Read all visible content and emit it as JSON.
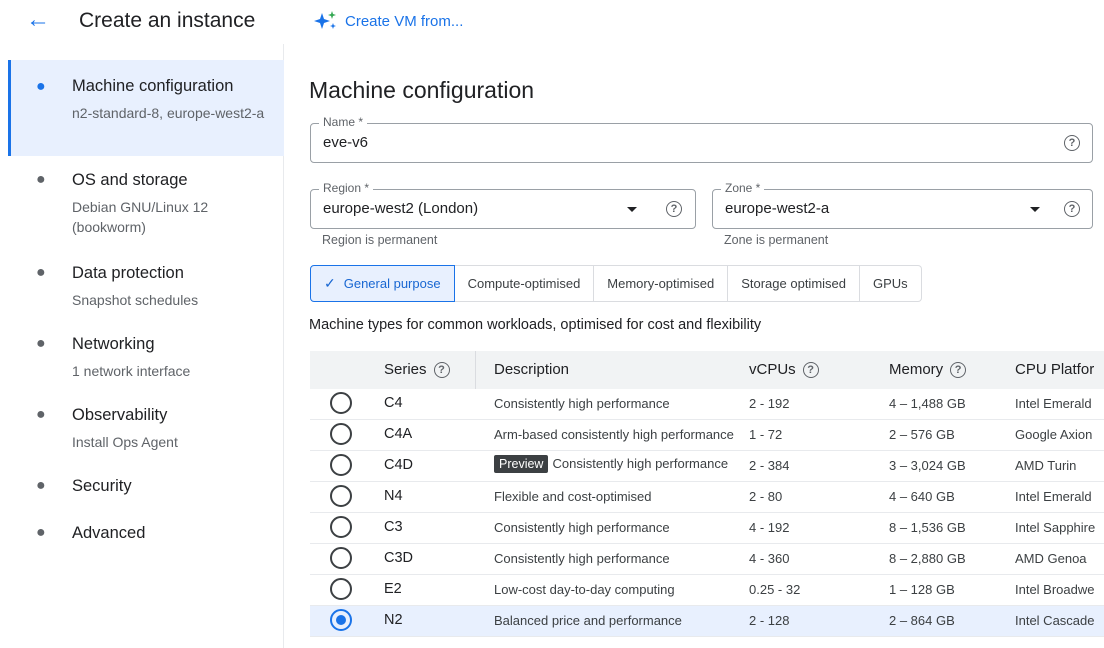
{
  "header": {
    "back_icon": "arrow-left-icon",
    "title": "Create an instance",
    "create_vm_label": "Create VM from...",
    "create_vm_icon": "sparkle-icon"
  },
  "sidebar": {
    "items": [
      {
        "label": "Machine configuration",
        "sub": "n2-standard-8, europe-west2-a",
        "active": true
      },
      {
        "label": "OS and storage",
        "sub": "Debian GNU/Linux 12 (bookworm)",
        "active": false
      },
      {
        "label": "Data protection",
        "sub": "Snapshot schedules",
        "active": false
      },
      {
        "label": "Networking",
        "sub": "1 network interface",
        "active": false
      },
      {
        "label": "Observability",
        "sub": "Install Ops Agent",
        "active": false
      },
      {
        "label": "Security",
        "sub": "",
        "active": false
      },
      {
        "label": "Advanced",
        "sub": "",
        "active": false
      }
    ]
  },
  "main": {
    "section_title": "Machine configuration",
    "name_field": {
      "label": "Name *",
      "value": "eve-v6"
    },
    "region_field": {
      "label": "Region *",
      "value": "europe-west2 (London)",
      "hint": "Region is permanent"
    },
    "zone_field": {
      "label": "Zone *",
      "value": "europe-west2-a",
      "hint": "Zone is permanent"
    },
    "tabs": [
      {
        "label": "General purpose",
        "selected": true
      },
      {
        "label": "Compute-optimised",
        "selected": false
      },
      {
        "label": "Memory-optimised",
        "selected": false
      },
      {
        "label": "Storage optimised",
        "selected": false
      },
      {
        "label": "GPUs",
        "selected": false
      }
    ],
    "tab_description": "Machine types for common workloads, optimised for cost and flexibility",
    "table": {
      "headers": {
        "series": "Series",
        "description": "Description",
        "vcpus": "vCPUs",
        "memory": "Memory",
        "cpu_platform": "CPU Platfor"
      },
      "rows": [
        {
          "series": "C4",
          "description": "Consistently high performance",
          "badge": "",
          "vcpus": "2 - 192",
          "memory": "4 – 1,488 GB",
          "cpu": "Intel Emerald",
          "selected": false
        },
        {
          "series": "C4A",
          "description": "Arm-based consistently high performance",
          "badge": "",
          "vcpus": "1 - 72",
          "memory": "2 – 576 GB",
          "cpu": "Google Axion",
          "selected": false
        },
        {
          "series": "C4D",
          "description": "Consistently high performance",
          "badge": "Preview",
          "vcpus": "2 - 384",
          "memory": "3 – 3,024 GB",
          "cpu": "AMD Turin",
          "selected": false
        },
        {
          "series": "N4",
          "description": "Flexible and cost-optimised",
          "badge": "",
          "vcpus": "2 - 80",
          "memory": "4 – 640 GB",
          "cpu": "Intel Emerald",
          "selected": false
        },
        {
          "series": "C3",
          "description": "Consistently high performance",
          "badge": "",
          "vcpus": "4 - 192",
          "memory": "8 – 1,536 GB",
          "cpu": "Intel Sapphire",
          "selected": false
        },
        {
          "series": "C3D",
          "description": "Consistently high performance",
          "badge": "",
          "vcpus": "4 - 360",
          "memory": "8 – 2,880 GB",
          "cpu": "AMD Genoa",
          "selected": false
        },
        {
          "series": "E2",
          "description": "Low-cost day-to-day computing",
          "badge": "",
          "vcpus": "0.25 - 32",
          "memory": "1 – 128 GB",
          "cpu": "Intel Broadwe",
          "selected": false
        },
        {
          "series": "N2",
          "description": "Balanced price and performance",
          "badge": "",
          "vcpus": "2 - 128",
          "memory": "2 – 864 GB",
          "cpu": "Intel Cascade",
          "selected": true
        }
      ]
    }
  },
  "colors": {
    "accent": "#1a73e8",
    "selected_bg": "#e8f0fe",
    "header_bg": "#f1f3f4"
  }
}
